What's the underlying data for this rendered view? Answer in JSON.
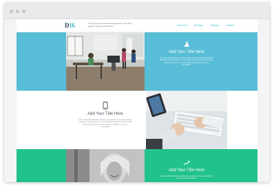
{
  "header": {
    "logo_text": "D",
    "logo_accent": "16",
    "tagline": "The source for tutorials and guides for web and graphic design practitioners",
    "nav": [
      "About Us",
      "Services",
      "Portfolio",
      "Contact"
    ]
  },
  "tiles": [
    {
      "title": "Add Your Title Here",
      "body": "This area of the website is meant to be used for copy that describes what your business does, you can talk about what you have to offer, what you believe and what makes you different from the competition.",
      "icon": "diagonal-arrows-icon"
    },
    {
      "title": "Add Your Title Here",
      "body": "This area of the website is meant to be used for copy that describes what your business does, you can talk about what you have to offer, what you believe and what makes you different from the competition.",
      "icon": "mobile-phone-icon"
    },
    {
      "title": "Add Your Title Here",
      "body": "This area of the website is meant to be used for copy that describes what your business does.",
      "icon": "trend-line-icon"
    }
  ],
  "colors": {
    "teal": "#58bdd6",
    "green": "#22c28c",
    "navy": "#2b3a55"
  }
}
